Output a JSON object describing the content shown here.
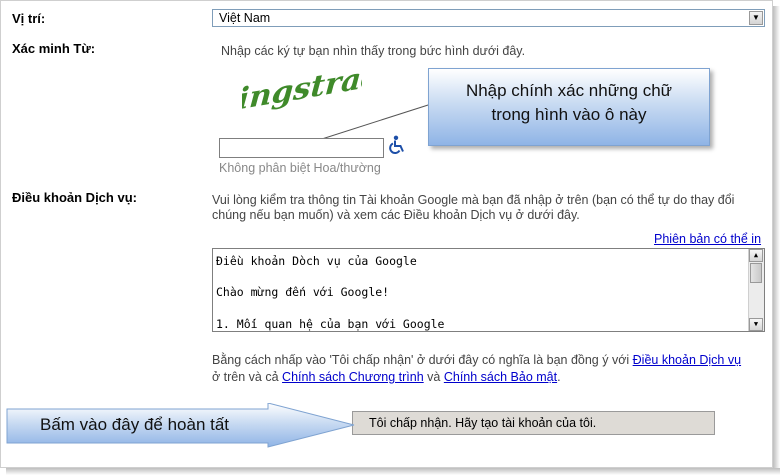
{
  "location": {
    "label": "Vị trí:",
    "value": "Việt Nam"
  },
  "verify": {
    "label": "Xác minh Từ:",
    "instruction": "Nhập các ký tự bạn nhìn thấy trong bức hình dưới đây.",
    "captcha_text": "ingstradr",
    "input_value": "",
    "hint": "Không phân biệt Hoa/thường"
  },
  "callout": {
    "line1": "Nhập chính xác những chữ",
    "line2": "trong hình vào ô này"
  },
  "terms": {
    "label": "Điều khoản Dịch vụ:",
    "intro_line1": "Vui lòng kiểm tra thông tin Tài khoản Google mà bạn đã nhập ở trên (bạn có thể tự do thay đổi",
    "intro_line2": "chúng nếu bạn muốn) và xem các Điều khoản Dịch vụ ở dưới đây.",
    "printable_link": "Phiên bản có thể in",
    "box_lines": [
      "Điều khoản Dòch vụ của Google",
      "Chào mừng đến với Google!",
      "1. Mối quan hệ của bạn với Google"
    ],
    "consent_part1": "Bằng cách nhấp vào 'Tôi chấp nhận' ở dưới đây có nghĩa là bạn đồng ý với ",
    "consent_link1": "Điều khoản Dịch vụ",
    "consent_part2": "ở trên và cả ",
    "consent_link2": "Chính sách Chương trình",
    "consent_part3": " và ",
    "consent_link3": "Chính sách Bảo mật",
    "consent_part4": "."
  },
  "accept_button": "Tôi chấp nhận. Hãy tạo tài khoản của tôi.",
  "arrow_callout": "Bấm vào đây để hoàn tất",
  "colors": {
    "link": "#0000cc",
    "callout_blue": "#8fb4e6",
    "captcha_green": "#3f8a2a"
  }
}
